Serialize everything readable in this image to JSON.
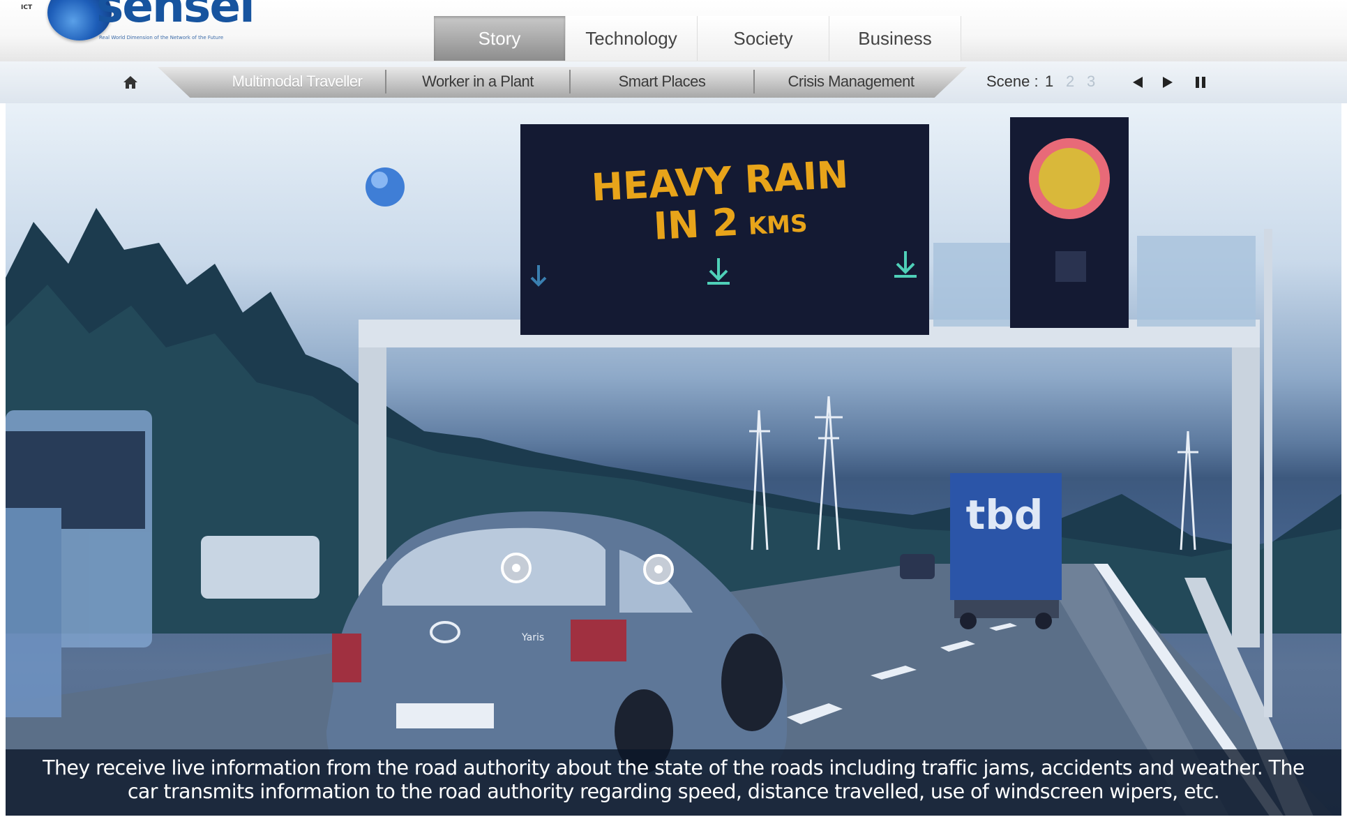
{
  "logo": {
    "brand": "sensei",
    "tagline": "Real World Dimension of the Network of the Future",
    "tiny": "ICT"
  },
  "main_tabs": [
    {
      "label": "Story",
      "active": true
    },
    {
      "label": "Technology",
      "active": false
    },
    {
      "label": "Society",
      "active": false
    },
    {
      "label": "Business",
      "active": false
    }
  ],
  "scenario_tabs": [
    {
      "label": "Multimodal Traveller",
      "active": true
    },
    {
      "label": "Worker in a Plant",
      "active": false
    },
    {
      "label": "Smart Places",
      "active": false
    },
    {
      "label": "Crisis Management",
      "active": false
    }
  ],
  "scene_nav": {
    "label": "Scene :",
    "numbers": [
      "1",
      "2",
      "3"
    ],
    "current": "1",
    "controls": [
      "previous-icon",
      "play-icon",
      "pause-icon"
    ]
  },
  "scene": {
    "sign_line1": "HEAVY RAIN",
    "sign_line2_main": "IN 2",
    "sign_line2_unit": "KMS",
    "truck_logo": "tbd",
    "car_brand": "Yaris"
  },
  "caption": "They receive live information from the road authority about the state of the roads including traffic jams, accidents and weather. The car transmits information to the road authority regarding speed, distance travelled, use of windscreen wipers, etc.",
  "colors": {
    "active_tab": "#8d8d8d",
    "sign_text": "#e8a41a",
    "caption_bg": "#0a1628"
  }
}
